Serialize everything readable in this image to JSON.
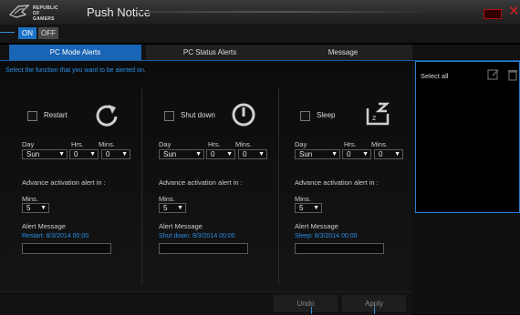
{
  "app": {
    "brand_line1": "REPUBLIC OF",
    "brand_line2": "GAMERS",
    "title": "Push Notice"
  },
  "toggle": {
    "on": "ON",
    "off": "OFF"
  },
  "tabs": [
    "PC Mode Alerts",
    "PC Status Alerts",
    "Message"
  ],
  "hint": "Select the function that you want to be alerted on.",
  "labels": {
    "day": "Day",
    "hrs": "Hrs.",
    "mins": "Mins.",
    "advance": "Advance activation alert in :",
    "alert_message": "Alert Message"
  },
  "columns": [
    {
      "title": "Restart",
      "day": "Sun",
      "hrs": "0",
      "mins": "0",
      "adv_mins": "5",
      "alert": "Restart: 8/3/2014 00:00"
    },
    {
      "title": "Shut down",
      "day": "Sun",
      "hrs": "0",
      "mins": "0",
      "adv_mins": "5",
      "alert": "Shut down: 8/3/2014 00:00"
    },
    {
      "title": "Sleep",
      "day": "Sun",
      "hrs": "0",
      "mins": "0",
      "adv_mins": "5",
      "alert": "Sleep: 8/3/2014 00:00"
    }
  ],
  "footer": {
    "undo": "Undo",
    "apply": "Apply"
  },
  "right_panel": {
    "select_all": "Select all"
  },
  "colors": {
    "accent": "#1d73c6",
    "highlight": "#2a8fe6",
    "close": "#d02020"
  }
}
